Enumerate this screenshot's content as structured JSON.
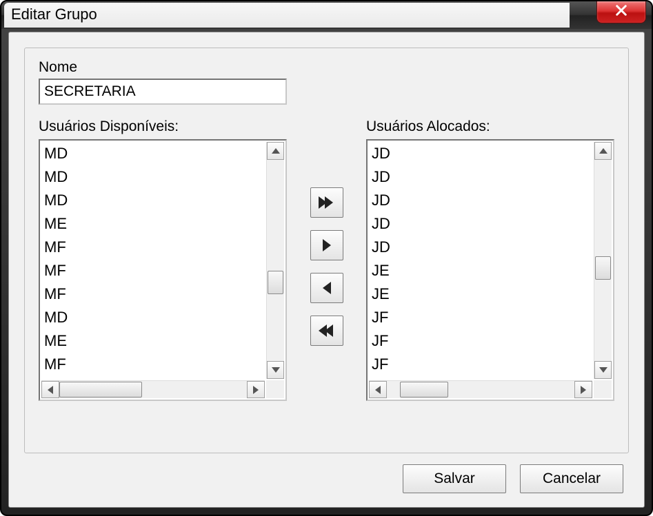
{
  "window": {
    "title": "Editar Grupo"
  },
  "form": {
    "name_label": "Nome",
    "name_value": "SECRETARIA"
  },
  "available": {
    "label": "Usuários Disponíveis:",
    "items": [
      "MD",
      "MD",
      "MD",
      "ME",
      "MF",
      "MF",
      "MF",
      "MD",
      "ME",
      "MF"
    ]
  },
  "allocated": {
    "label": "Usuários Alocados:",
    "items": [
      "JD",
      "JD",
      "JD",
      "JD",
      "JD",
      "JE",
      "JE",
      "JF",
      "JF",
      "JF"
    ]
  },
  "buttons": {
    "save": "Salvar",
    "cancel": "Cancelar"
  },
  "icons": {
    "close": "close-icon",
    "move_all_right": "double-chevron-right-icon",
    "move_right": "chevron-right-icon",
    "move_left": "chevron-left-icon",
    "move_all_left": "double-chevron-left-icon"
  }
}
